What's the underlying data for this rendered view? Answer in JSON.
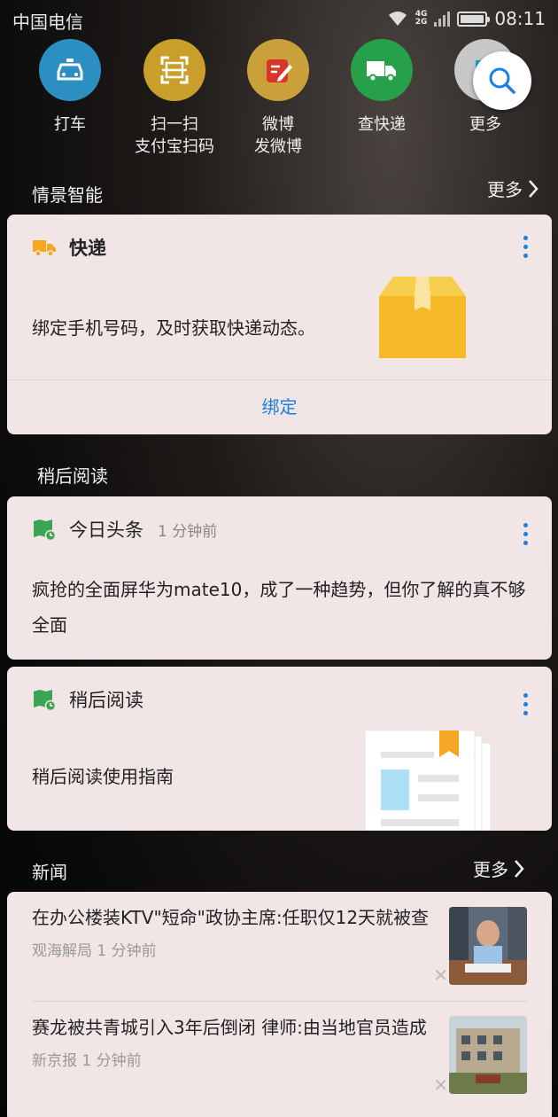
{
  "status": {
    "carrier": "中国电信",
    "network_top": "4G",
    "network_bottom": "2G",
    "time": "08:11"
  },
  "quick_apps": [
    {
      "label": "打车",
      "icon": "taxi-icon"
    },
    {
      "label": "扫一扫\n支付宝扫码",
      "icon": "scan-icon"
    },
    {
      "label": "微博\n发微博",
      "icon": "weibo-edit-icon"
    },
    {
      "label": "查快递",
      "icon": "truck-icon"
    },
    {
      "label": "更多",
      "icon": "grid-icon"
    }
  ],
  "smart": {
    "title": "情景智能",
    "more": "更多"
  },
  "express_card": {
    "title": "快递",
    "text": "绑定手机号码，及时获取快递动态。",
    "action": "绑定"
  },
  "read_later": {
    "section_title": "稍后阅读",
    "headline_card": {
      "source": "今日头条",
      "time": "1 分钟前",
      "text": "疯抢的全面屏华为mate10，成了一种趋势，但你了解的真不够全面"
    },
    "guide_card": {
      "title": "稍后阅读",
      "text": "稍后阅读使用指南"
    }
  },
  "news": {
    "title": "新闻",
    "more": "更多",
    "items": [
      {
        "title": "在办公楼装KTV\"短命\"政协主席:任职仅12天就被查",
        "source": "观海解局",
        "time": "1 分钟前"
      },
      {
        "title": "赛龙被共青城引入3年后倒闭 律师:由当地官员造成",
        "source": "新京报",
        "time": "1 分钟前"
      }
    ]
  },
  "colors": {
    "accent_blue": "#1b7fe0",
    "card_bg": "#f1e6e5"
  }
}
